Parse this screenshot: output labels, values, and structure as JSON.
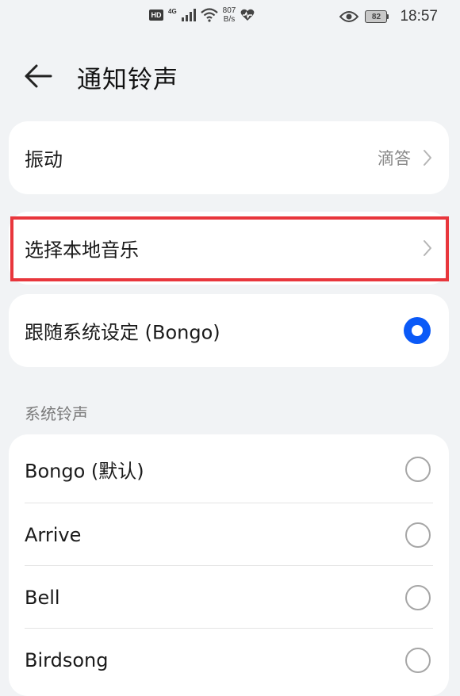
{
  "status_bar": {
    "hd": "HD",
    "network": "4G",
    "speed_value": "807",
    "speed_unit": "B/s",
    "battery": "82",
    "time": "18:57",
    "icons": [
      "signal-icon",
      "wifi-icon",
      "heart-health-icon",
      "eye-icon",
      "battery-icon"
    ]
  },
  "header": {
    "back_icon": "arrow-left-icon",
    "title": "通知铃声"
  },
  "vibration": {
    "label": "振动",
    "value": "滴答"
  },
  "local_music": {
    "label": "选择本地音乐"
  },
  "follow_system": {
    "label": "跟随系统设定 (Bongo)",
    "selected": true
  },
  "system_ringtones": {
    "title": "系统铃声",
    "items": [
      {
        "label": "Bongo (默认)",
        "selected": false
      },
      {
        "label": "Arrive",
        "selected": false
      },
      {
        "label": "Bell",
        "selected": false
      },
      {
        "label": "Birdsong",
        "selected": false
      }
    ]
  },
  "colors": {
    "accent": "#0a59f7",
    "highlight": "#e8363c",
    "background": "#f1f3f5"
  }
}
